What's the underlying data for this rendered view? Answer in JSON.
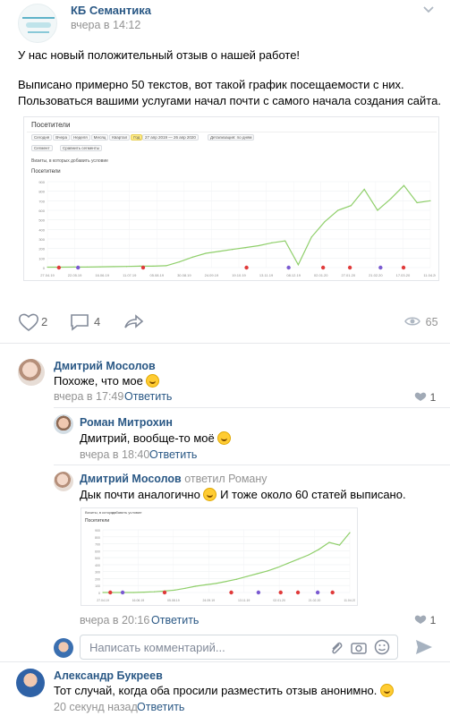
{
  "post": {
    "author": "КБ Семантика",
    "time": "вчера в 14:12",
    "text_line1": "У нас новый положительный отзыв о нашей работе!",
    "text_line2": "Выписано примерно 50 текстов, вот такой график посещаемости с них.",
    "text_line3": "Пользоваться вашими услугами начал почти с самого начала создания сайта.",
    "likes": "2",
    "comments": "4",
    "views": "65"
  },
  "stats_image": {
    "title": "Посетители",
    "periods": [
      "Сегодня",
      "Вчера",
      "Неделя",
      "Месяц",
      "Квартал",
      "Год"
    ],
    "active_period": "Год",
    "date_range": "27 апр 2019 — 26 апр 2020",
    "detail": "Детализация: по дням",
    "sub_controls": [
      "Сегмент",
      "Сравнить сегменты"
    ],
    "sub_controls_2": [
      "Визиты, в которых",
      "добавить условие"
    ],
    "metric_label": "Посетители",
    "x_ticks": [
      "27.04.19",
      "22.05.19",
      "16.06.19",
      "11.07.19",
      "05.08.19",
      "30.08.19",
      "24.09.19",
      "19.10.19",
      "13.11.19",
      "08.12.19",
      "02.01.20",
      "27.01.20",
      "21.02.20",
      "17.03.20",
      "11.04.20"
    ],
    "y_ticks": [
      "900",
      "800",
      "700",
      "600",
      "500",
      "400",
      "300",
      "200",
      "100",
      "0"
    ]
  },
  "chart_data": [
    {
      "type": "line",
      "title": "Посетители",
      "series": [
        {
          "name": "Посетители",
          "values": [
            5,
            5,
            6,
            6,
            8,
            10,
            12,
            15,
            15,
            20,
            60,
            110,
            150,
            170,
            190,
            210,
            230,
            260,
            280,
            30,
            320,
            480,
            600,
            650,
            820,
            600,
            720,
            860,
            680,
            700
          ]
        }
      ],
      "ylim": [
        0,
        900
      ]
    },
    {
      "type": "line",
      "title": "Посетители",
      "series": [
        {
          "name": "Посетители",
          "values": [
            0,
            0,
            0,
            0,
            5,
            10,
            20,
            35,
            60,
            90,
            110,
            130,
            160,
            190,
            230,
            270,
            310,
            360,
            420,
            480,
            540,
            620,
            720,
            680,
            860
          ]
        }
      ],
      "ylim": [
        0,
        900
      ]
    }
  ],
  "comments": [
    {
      "name": "Дмитрий Мосолов",
      "text": "Похоже, что мое",
      "time": "вчера в 17:49",
      "reply": "Ответить",
      "likes": "1"
    },
    {
      "name": "Роман Митрохин",
      "text": "Дмитрий, вообще-то моё",
      "time": "вчера в 18:40",
      "reply": "Ответить"
    },
    {
      "name": "Дмитрий Мосолов",
      "answered": "ответил Роману",
      "text": "Дык почти аналогично",
      "text2": "И тоже около 60 статей выписано.",
      "time": "вчера в 20:16",
      "reply": "Ответить",
      "likes": "1"
    },
    {
      "name": "Александр Букреев",
      "text": "Тот случай, когда оба просили разместить отзыв анонимно.",
      "time": "20 секунд назад",
      "reply": "Ответить"
    }
  ],
  "composer": {
    "placeholder": "Написать комментарий..."
  },
  "colors": {
    "link": "#2a5885",
    "meta": "#939393",
    "line": "#8fcf6a",
    "accent": "#ffeb84"
  }
}
